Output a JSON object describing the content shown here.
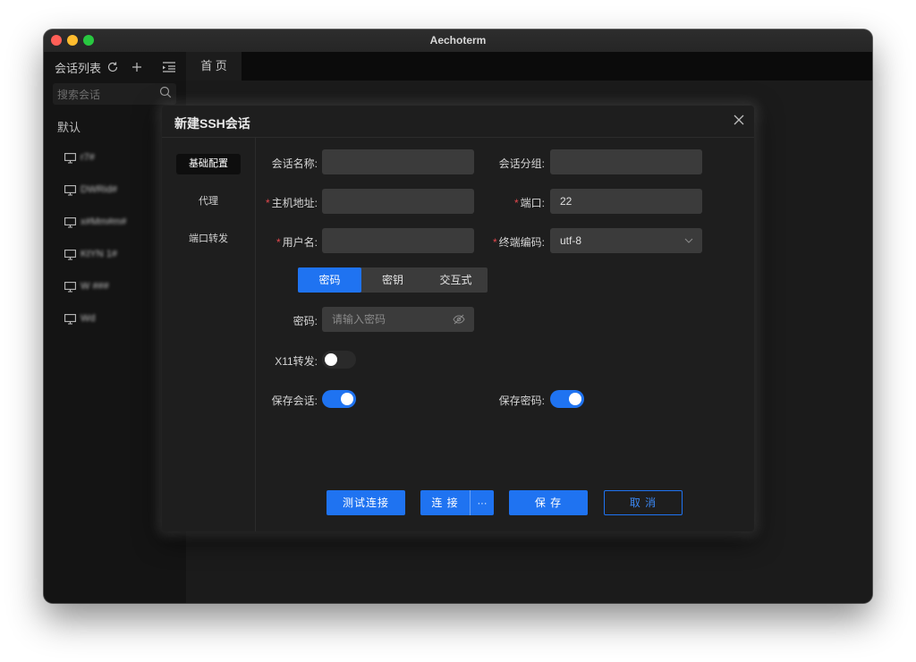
{
  "window": {
    "title": "Aechoterm"
  },
  "sidebar": {
    "header_label": "会话列表",
    "search_placeholder": "搜索会话",
    "group_label": "默认",
    "sessions": [
      "r7#",
      "DWRid#",
      "x#Mm#m#",
      "KtYN 1#",
      "W ###",
      "Wd"
    ]
  },
  "tabs": [
    {
      "label": "首 页"
    }
  ],
  "dialog": {
    "title": "新建SSH会话",
    "side_menu": [
      "基础配置",
      "代理",
      "端口转发"
    ],
    "active_side": "基础配置",
    "fields": {
      "session_name_label": "会话名称:",
      "session_group_label": "会话分组:",
      "host_label": "主机地址:",
      "port_label": "端口:",
      "port_value": "22",
      "username_label": "用户名:",
      "encoding_label": "终端编码:",
      "encoding_value": "utf-8",
      "required_mark": "*"
    },
    "auth_tabs": [
      "密码",
      "密钥",
      "交互式"
    ],
    "auth_active": "密码",
    "password_label": "密码:",
    "password_placeholder": "请输入密码",
    "x11_label": "X11转发:",
    "x11_enabled": false,
    "save_session_label": "保存会话:",
    "save_session_enabled": true,
    "save_password_label": "保存密码:",
    "save_password_enabled": true,
    "buttons": {
      "test": "测试连接",
      "connect": "连 接",
      "connect_more": "···",
      "save": "保 存",
      "cancel": "取 消"
    }
  },
  "colors": {
    "accent": "#1f73f1",
    "required": "#e5484d",
    "dialog_bg": "#1e1e1e",
    "input_bg": "#3b3b3b"
  }
}
